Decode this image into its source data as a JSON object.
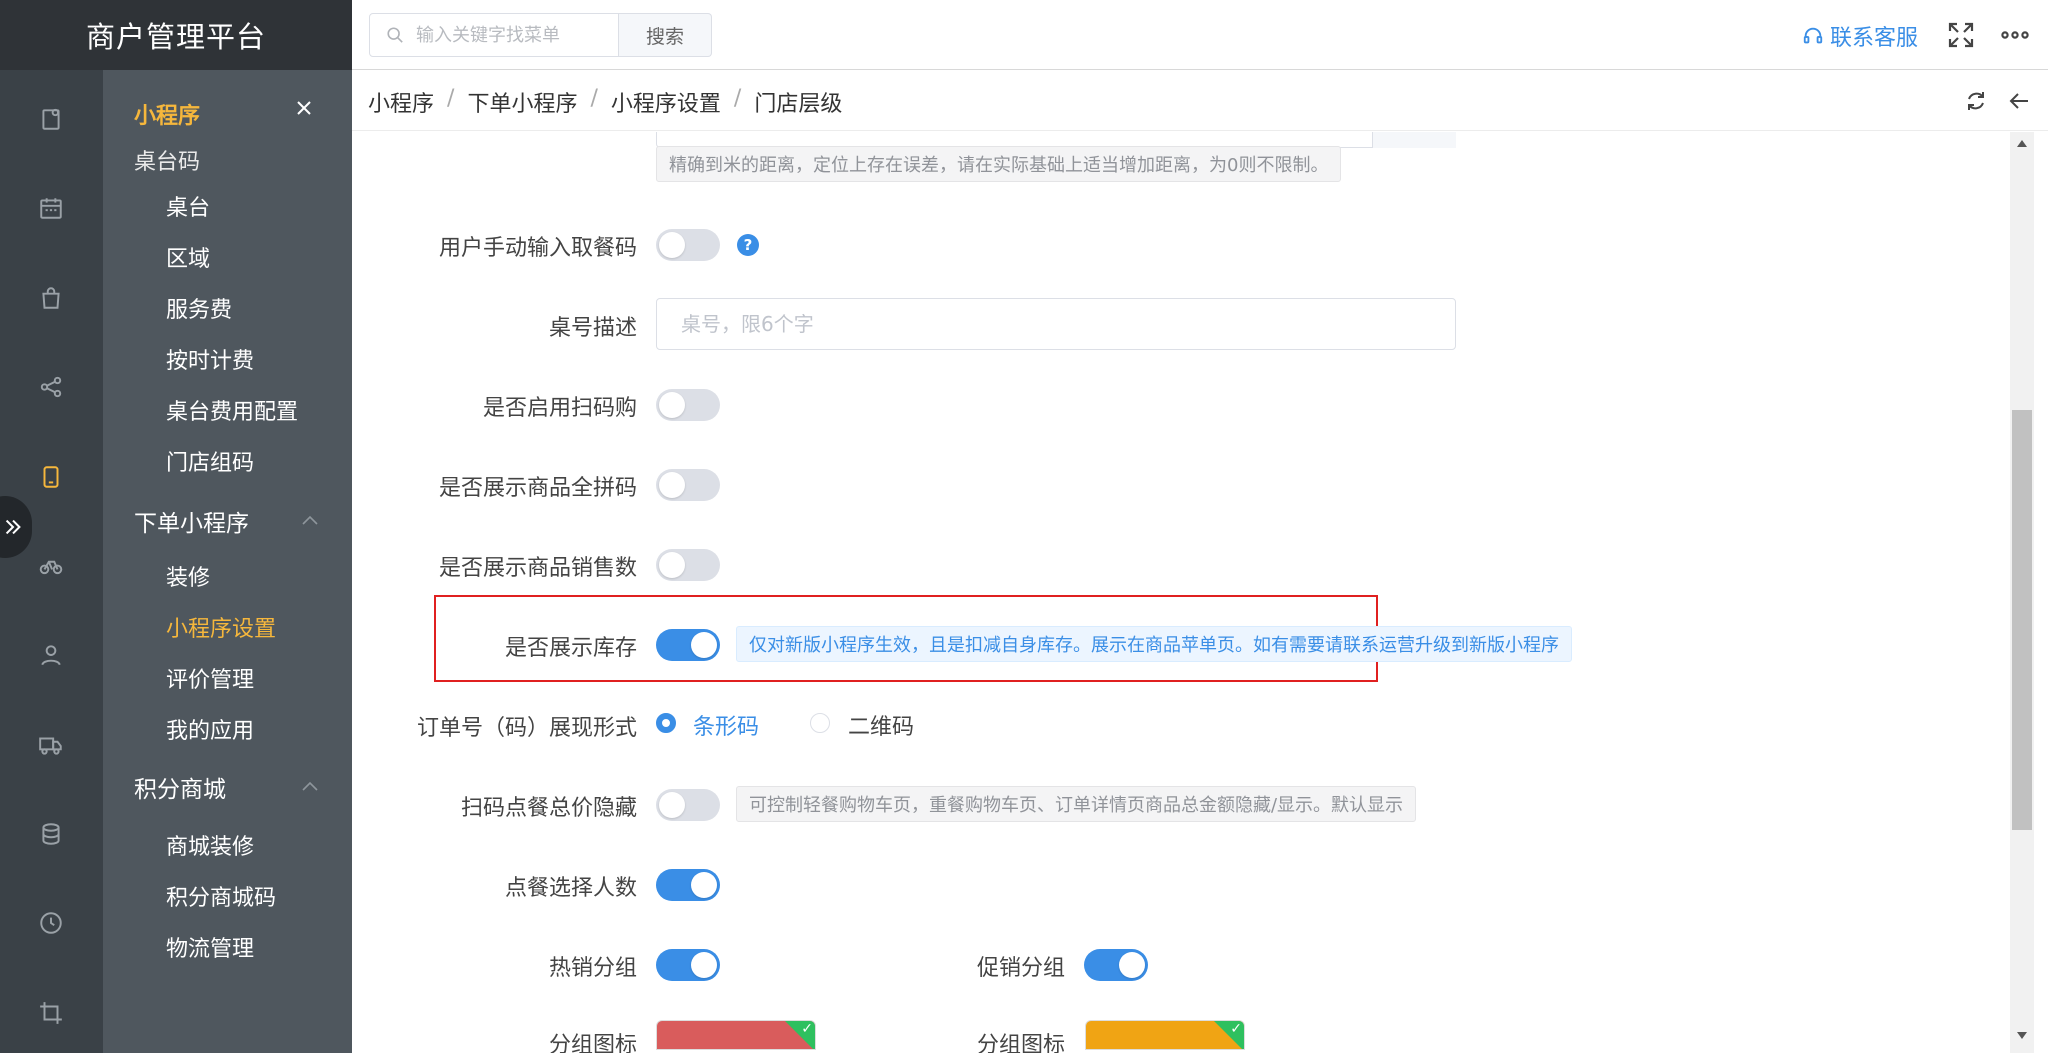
{
  "brand": {
    "title": "商户管理平台"
  },
  "topbar": {
    "search_placeholder": "输入关键字找菜单",
    "search_button": "搜索",
    "contact_label": "联系客服"
  },
  "breadcrumb": [
    "小程序",
    "下单小程序",
    "小程序设置",
    "门店层级"
  ],
  "submenu": {
    "title": "小程序",
    "partial_group": "桌台码",
    "group1_items": [
      "桌台",
      "区域",
      "服务费",
      "按时计费",
      "桌台费用配置",
      "门店组码"
    ],
    "group2": {
      "title": "下单小程序",
      "items": [
        "装修",
        "小程序设置",
        "评价管理",
        "我的应用"
      ],
      "active": "小程序设置"
    },
    "group3": {
      "title": "积分商城",
      "items": [
        "商城装修",
        "积分商城码",
        "物流管理"
      ]
    }
  },
  "form": {
    "distance_hint": "精确到米的距离，定位上存在误差，请在实际基础上适当增加距离，为0则不限制。",
    "manual_code": {
      "label": "用户手动输入取餐码",
      "on": false
    },
    "table_desc": {
      "label": "桌号描述",
      "placeholder": "桌号，限6个字"
    },
    "scan_buy": {
      "label": "是否启用扫码购",
      "on": false
    },
    "pinyin": {
      "label": "是否展示商品全拼码",
      "on": false
    },
    "sales": {
      "label": "是否展示商品销售数",
      "on": false
    },
    "stock": {
      "label": "是否展示库存",
      "on": true,
      "hint": "仅对新版小程序生效，且是扣减自身库存。展示在商品苹单页。如有需要请联系运营升级到新版小程序"
    },
    "order_code": {
      "label": "订单号（码）展现形式",
      "options": [
        "条形码",
        "二维码"
      ],
      "selected": "条形码"
    },
    "hide_total": {
      "label": "扫码点餐总价隐藏",
      "on": false,
      "hint": "可控制轻餐购物车页，重餐购物车页、订单详情页商品总金额隐藏/显示。默认显示"
    },
    "people": {
      "label": "点餐选择人数",
      "on": true
    },
    "hot_group": {
      "label": "热销分组",
      "on": true
    },
    "promo_group": {
      "label": "促销分组",
      "on": true
    },
    "group_icon_label": "分组图标"
  },
  "colors": {
    "accent": "#3a8ee6",
    "menu_active": "#f6b73c",
    "highlight_border": "#e02020"
  }
}
